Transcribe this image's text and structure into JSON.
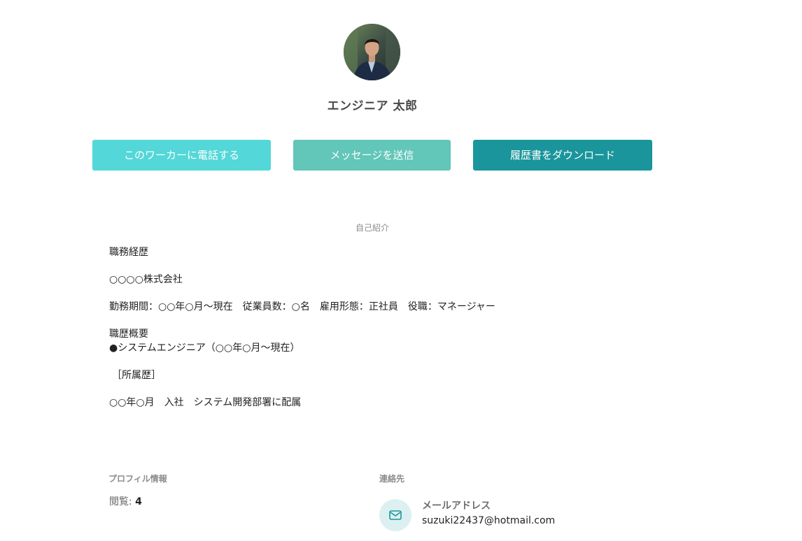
{
  "profile": {
    "name": "エンジニア 太郎"
  },
  "actions": {
    "call_label": "このワーカーに電話する",
    "message_label": "メッセージを送信",
    "download_label": "履歴書をダウンロード"
  },
  "intro": {
    "title": "自己紹介",
    "lines": [
      "職務経歴",
      "○○○○株式会社",
      "勤務期間：○○年○月～現在　従業員数：○名　雇用形態：正社員　役職：マネージャー",
      "職歴概要",
      "●システムエンジニア（○○年○月～現在）",
      "［所属歴］",
      "○○年○月　入社　システム開発部署に配属"
    ]
  },
  "profile_info": {
    "heading": "プロフィル情報",
    "views_label": "閲覧:",
    "views_count": "4"
  },
  "contact": {
    "heading": "連絡先",
    "email_label": "メールアドレス",
    "email_value": "suzuki22437@hotmail.com"
  },
  "colors": {
    "call_button": "#53d7d8",
    "message_button": "#62c6b8",
    "download_button": "#1a959b",
    "icon_circle": "#dcf0f1"
  }
}
